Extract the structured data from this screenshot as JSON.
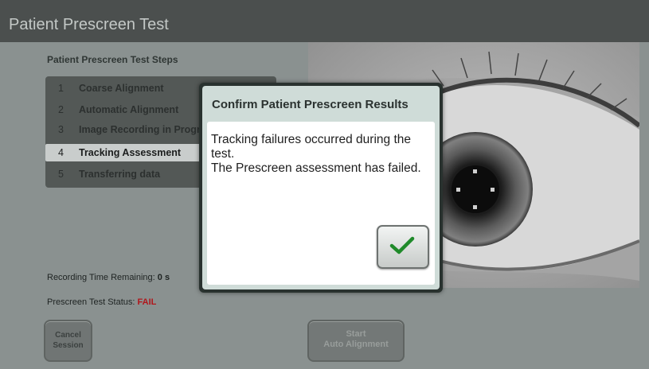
{
  "window": {
    "title": "Patient Prescreen Test"
  },
  "steps": {
    "heading": "Patient Prescreen Test Steps",
    "items": [
      {
        "num": "1",
        "label": "Coarse Alignment"
      },
      {
        "num": "2",
        "label": "Automatic Alignment"
      },
      {
        "num": "3",
        "label": "Image Recording in Progress"
      },
      {
        "num": "4",
        "label": "Tracking Assessment"
      },
      {
        "num": "5",
        "label": "Transferring data"
      }
    ],
    "active_index": 3
  },
  "recording": {
    "label": "Recording Time Remaining:",
    "value": "0 s"
  },
  "status": {
    "label": "Prescreen Test Status:",
    "value": "FAIL"
  },
  "buttons": {
    "cancel_line1": "Cancel",
    "cancel_line2": "Session",
    "start_line1": "Start",
    "start_line2": "Auto Alignment"
  },
  "dialog": {
    "title": "Confirm Patient Prescreen Results",
    "message": "Tracking failures occurred during the test.\nThe Prescreen assessment has failed.",
    "ok_icon": "checkmark-icon"
  },
  "colors": {
    "fail": "#b0161b",
    "check": "#1f8a2a"
  }
}
